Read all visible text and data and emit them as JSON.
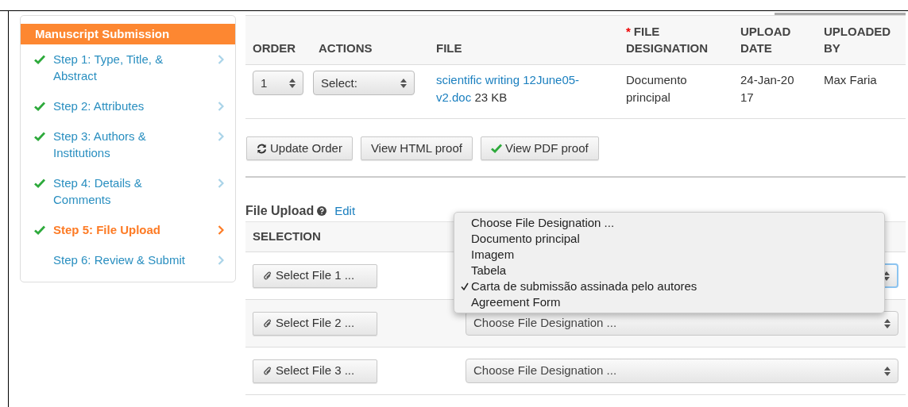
{
  "sidebar": {
    "title": "Manuscript Submission",
    "steps": [
      {
        "label": "Step 1: Type, Title, & Abstract",
        "completed": true,
        "selected": false
      },
      {
        "label": "Step 2: Attributes",
        "completed": true,
        "selected": false
      },
      {
        "label": "Step 3: Authors & Institutions",
        "completed": true,
        "selected": false
      },
      {
        "label": "Step 4: Details & Comments",
        "completed": true,
        "selected": false
      },
      {
        "label": "Step 5: File Upload",
        "completed": true,
        "selected": true
      },
      {
        "label": "Step 6: Review & Submit",
        "completed": false,
        "selected": false
      }
    ]
  },
  "files_table": {
    "columns": [
      {
        "label": "ORDER",
        "required": false
      },
      {
        "label": "ACTIONS",
        "required": false
      },
      {
        "label": "FILE",
        "required": false
      },
      {
        "label": "FILE DESIGNATION",
        "required": true,
        "marker": "*"
      },
      {
        "label": "UPLOAD DATE",
        "required": false
      },
      {
        "label": "UPLOADED BY",
        "required": false
      }
    ],
    "rows": [
      {
        "order": "1",
        "action": "Select:",
        "file_name": "scientific writing 12June05-v2.doc",
        "file_size": "23 KB",
        "designation": "Documento principal",
        "upload_date": "24-Jan-2017",
        "uploaded_by": "Max Faria"
      }
    ]
  },
  "buttons": [
    {
      "label": "Update Order",
      "kind": "refresh"
    },
    {
      "label": "View HTML proof",
      "kind": "plain"
    },
    {
      "label": "View PDF proof",
      "kind": "check"
    }
  ],
  "file_upload": {
    "title": "File Upload",
    "edit_link": "Edit",
    "column": "SELECTION",
    "rows": [
      {
        "button": "Select File 1 ...",
        "designation": "",
        "focused": true
      },
      {
        "button": "Select File 2 ...",
        "designation": "Choose File Designation ...",
        "focused": false
      },
      {
        "button": "Select File 3 ...",
        "designation": "Choose File Designation ...",
        "focused": false
      }
    ],
    "open_menu": [
      {
        "label": "Choose File Designation ...",
        "selected": false
      },
      {
        "label": "Documento principal",
        "selected": false
      },
      {
        "label": "Imagem",
        "selected": false
      },
      {
        "label": "Tabela",
        "selected": false
      },
      {
        "label": "Carta de submissão assinada pelo autores",
        "selected": true
      },
      {
        "label": "Agreement Form",
        "selected": false
      }
    ]
  }
}
